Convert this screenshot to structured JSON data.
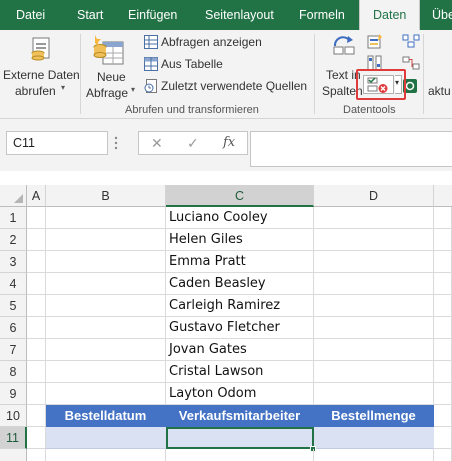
{
  "ribbon_tabs": [
    {
      "label": "Datei"
    },
    {
      "label": "Start"
    },
    {
      "label": "Einfügen"
    },
    {
      "label": "Seitenlayout"
    },
    {
      "label": "Formeln"
    },
    {
      "label": "Daten",
      "active": true
    },
    {
      "label": "Über"
    }
  ],
  "ribbon": {
    "external_data": {
      "line1": "Externe Daten",
      "line2": "abrufen"
    },
    "new_query": {
      "line1": "Neue",
      "line2": "Abfrage"
    },
    "show_queries": "Abfragen anzeigen",
    "from_table": "Aus Tabelle",
    "recent_sources": "Zuletzt verwendete Quellen",
    "group_get_transform": "Abrufen und transformieren",
    "text_to_columns": {
      "line1": "Text in",
      "line2": "Spalten"
    },
    "group_datatools": "Datentools",
    "refresh_all_partial": "aktu",
    "highlight_color": "#e03b3b"
  },
  "formula_bar": {
    "name_box": "C11",
    "cancel_symbol": "✕",
    "enter_symbol": "✓",
    "fx_symbol": "fx",
    "formula": ""
  },
  "sheet": {
    "column_headers": [
      "A",
      "B",
      "C",
      "D"
    ],
    "selected_column": "C",
    "selected_row": "11",
    "rows": [
      {
        "row": "1",
        "c": "Luciano Cooley"
      },
      {
        "row": "2",
        "c": "Helen Giles"
      },
      {
        "row": "3",
        "c": "Emma Pratt"
      },
      {
        "row": "4",
        "c": "Caden Beasley"
      },
      {
        "row": "5",
        "c": "Carleigh Ramirez"
      },
      {
        "row": "6",
        "c": "Gustavo Fletcher"
      },
      {
        "row": "7",
        "c": "Jovan Gates"
      },
      {
        "row": "8",
        "c": "Cristal Lawson"
      },
      {
        "row": "9",
        "c": "Layton Odom"
      }
    ],
    "header_row": {
      "row": "10",
      "b": "Bestelldatum",
      "c": "Verkaufsmitarbeiter",
      "d": "Bestellmenge"
    },
    "data_row": {
      "row": "11"
    },
    "table_header_color": "#4472c4",
    "table_band_color": "#d9e1f2"
  }
}
